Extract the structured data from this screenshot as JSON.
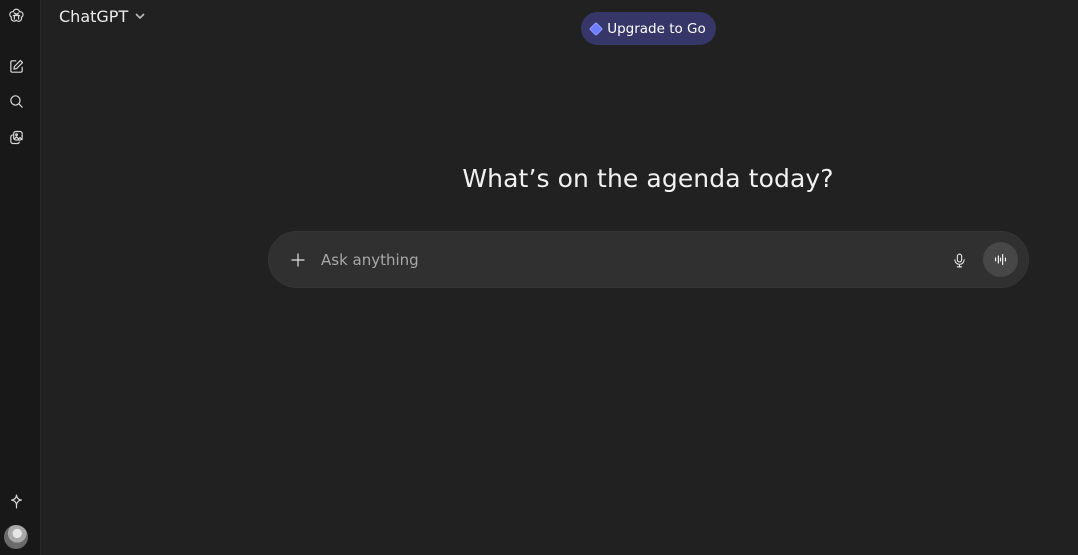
{
  "header": {
    "model_name": "ChatGPT",
    "upgrade_label": "Upgrade to Go"
  },
  "sidebar": {
    "icons": [
      "openai-logo-icon",
      "new-chat-icon",
      "search-icon",
      "library-icon",
      "sparkle-icon",
      "avatar"
    ]
  },
  "main": {
    "headline": "What’s on the agenda today?"
  },
  "composer": {
    "placeholder": "Ask anything",
    "value": ""
  },
  "colors": {
    "background": "#212121",
    "sidebar": "#181818",
    "composer": "#303030",
    "upgrade_bg": "#373669",
    "upgrade_icon": "#6f7dff"
  }
}
